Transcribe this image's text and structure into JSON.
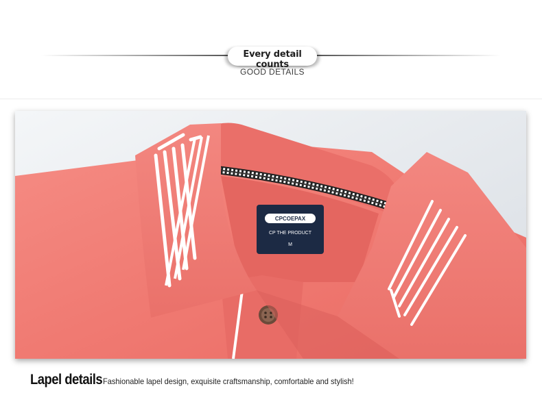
{
  "header": {
    "title": "Every detail counts",
    "subtitle": "GOOD DETAILS"
  },
  "photo": {
    "label": {
      "brand": "CPCOEPAX",
      "line2": "CP THE PRODUCT",
      "size": "M"
    },
    "colors": {
      "shirt": "#f07a72",
      "stripe": "#ffffff",
      "label": "#1c2a44"
    }
  },
  "caption": {
    "title": "Lapel details",
    "text": "Fashionable lapel design, exquisite craftsmanship, comfortable and stylish!"
  }
}
